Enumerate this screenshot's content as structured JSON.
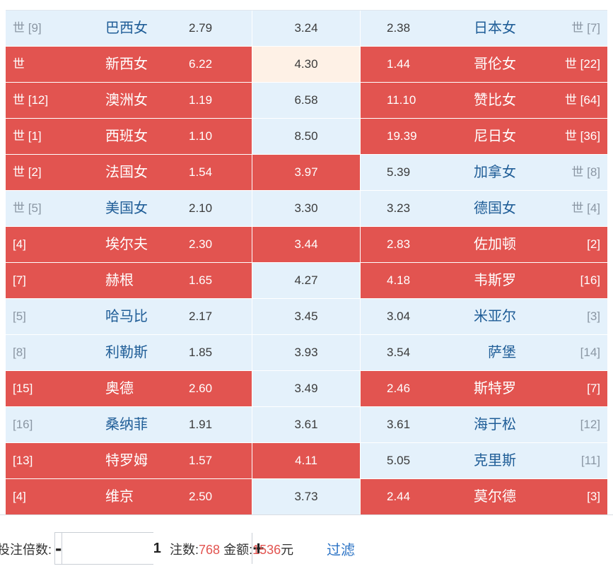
{
  "colors": {
    "pale": "#e4f1fb",
    "hot": "#e25450",
    "warm": "#fef1e6",
    "team": "#1f5d97",
    "accent": "#e25450",
    "link": "#2b73c5"
  },
  "matches": [
    {
      "home_rank": "世 [9]",
      "home": "巴西女",
      "home_odds": "2.79",
      "draw_odds": "3.24",
      "away_odds": "2.38",
      "away": "日本女",
      "away_rank": "世 [7]",
      "home_sel": false,
      "draw_sel": false,
      "draw_warm": false,
      "away_sel": false
    },
    {
      "home_rank": "世",
      "home": "新西女",
      "home_odds": "6.22",
      "draw_odds": "4.30",
      "away_odds": "1.44",
      "away": "哥伦女",
      "away_rank": "世 [22]",
      "home_sel": true,
      "draw_sel": false,
      "draw_warm": true,
      "away_sel": true
    },
    {
      "home_rank": "世 [12]",
      "home": "澳洲女",
      "home_odds": "1.19",
      "draw_odds": "6.58",
      "away_odds": "11.10",
      "away": "赞比女",
      "away_rank": "世 [64]",
      "home_sel": true,
      "draw_sel": false,
      "draw_warm": false,
      "away_sel": true
    },
    {
      "home_rank": "世 [1]",
      "home": "西班女",
      "home_odds": "1.10",
      "draw_odds": "8.50",
      "away_odds": "19.39",
      "away": "尼日女",
      "away_rank": "世 [36]",
      "home_sel": true,
      "draw_sel": false,
      "draw_warm": false,
      "away_sel": true
    },
    {
      "home_rank": "世 [2]",
      "home": "法国女",
      "home_odds": "1.54",
      "draw_odds": "3.97",
      "away_odds": "5.39",
      "away": "加拿女",
      "away_rank": "世 [8]",
      "home_sel": true,
      "draw_sel": true,
      "draw_warm": false,
      "away_sel": false
    },
    {
      "home_rank": "世 [5]",
      "home": "美国女",
      "home_odds": "2.10",
      "draw_odds": "3.30",
      "away_odds": "3.23",
      "away": "德国女",
      "away_rank": "世 [4]",
      "home_sel": false,
      "draw_sel": false,
      "draw_warm": false,
      "away_sel": false
    },
    {
      "home_rank": "[4]",
      "home": "埃尔夫",
      "home_odds": "2.30",
      "draw_odds": "3.44",
      "away_odds": "2.83",
      "away": "佐加顿",
      "away_rank": "[2]",
      "home_sel": true,
      "draw_sel": true,
      "draw_warm": false,
      "away_sel": true
    },
    {
      "home_rank": "[7]",
      "home": "赫根",
      "home_odds": "1.65",
      "draw_odds": "4.27",
      "away_odds": "4.18",
      "away": "韦斯罗",
      "away_rank": "[16]",
      "home_sel": true,
      "draw_sel": false,
      "draw_warm": false,
      "away_sel": true
    },
    {
      "home_rank": "[5]",
      "home": "哈马比",
      "home_odds": "2.17",
      "draw_odds": "3.45",
      "away_odds": "3.04",
      "away": "米亚尔",
      "away_rank": "[3]",
      "home_sel": false,
      "draw_sel": false,
      "draw_warm": false,
      "away_sel": false
    },
    {
      "home_rank": "[8]",
      "home": "利勒斯",
      "home_odds": "1.85",
      "draw_odds": "3.93",
      "away_odds": "3.54",
      "away": "萨堡",
      "away_rank": "[14]",
      "home_sel": false,
      "draw_sel": false,
      "draw_warm": false,
      "away_sel": false
    },
    {
      "home_rank": "[15]",
      "home": "奥德",
      "home_odds": "2.60",
      "draw_odds": "3.49",
      "away_odds": "2.46",
      "away": "斯特罗",
      "away_rank": "[7]",
      "home_sel": true,
      "draw_sel": false,
      "draw_warm": false,
      "away_sel": true
    },
    {
      "home_rank": "[16]",
      "home": "桑纳菲",
      "home_odds": "1.91",
      "draw_odds": "3.61",
      "away_odds": "3.61",
      "away": "海于松",
      "away_rank": "[12]",
      "home_sel": false,
      "draw_sel": false,
      "draw_warm": false,
      "away_sel": false
    },
    {
      "home_rank": "[13]",
      "home": "特罗姆",
      "home_odds": "1.57",
      "draw_odds": "4.11",
      "away_odds": "5.05",
      "away": "克里斯",
      "away_rank": "[11]",
      "home_sel": true,
      "draw_sel": true,
      "draw_warm": false,
      "away_sel": false
    },
    {
      "home_rank": "[4]",
      "home": "维京",
      "home_odds": "2.50",
      "draw_odds": "3.73",
      "away_odds": "2.44",
      "away": "莫尔德",
      "away_rank": "[3]",
      "home_sel": true,
      "draw_sel": false,
      "draw_warm": false,
      "away_sel": true
    }
  ],
  "footer": {
    "multiplier_label": "投注倍数:",
    "minus_label": "-",
    "plus_label": "+",
    "multiplier_value": "1",
    "bets_label": "注数:",
    "bets_value": "768",
    "amount_label": "金额:",
    "amount_value": "1536",
    "amount_unit": "元",
    "filter_label": "过滤"
  }
}
